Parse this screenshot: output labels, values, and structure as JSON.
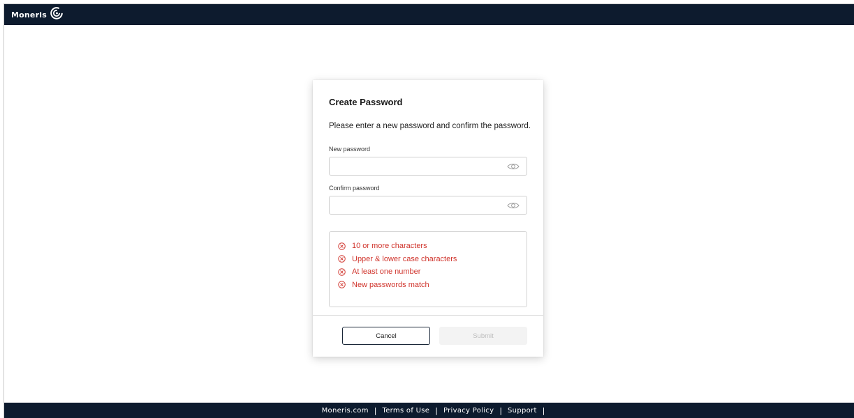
{
  "header": {
    "brand": "Moneris"
  },
  "dialog": {
    "title": "Create Password",
    "description": "Please enter a new password and confirm the password.",
    "new_password": {
      "label": "New password",
      "value": "",
      "placeholder": ""
    },
    "confirm_password": {
      "label": "Confirm password",
      "value": "",
      "placeholder": ""
    },
    "requirements": [
      {
        "label": "10 or more characters",
        "status": "unmet"
      },
      {
        "label": "Upper & lower case characters",
        "status": "unmet"
      },
      {
        "label": "At least one number",
        "status": "unmet"
      },
      {
        "label": "New passwords match",
        "status": "unmet"
      }
    ],
    "cancel_label": "Cancel",
    "submit_label": "Submit"
  },
  "footer": {
    "links": [
      "Moneris.com",
      "Terms of Use",
      "Privacy Policy",
      "Support"
    ]
  },
  "colors": {
    "navy": "#0d1b2e",
    "error_red": "#d0342c",
    "disabled_bg": "#f3f3f3"
  },
  "icons": {
    "show_password": "eye-icon",
    "requirement_unmet": "circle-x-icon"
  }
}
